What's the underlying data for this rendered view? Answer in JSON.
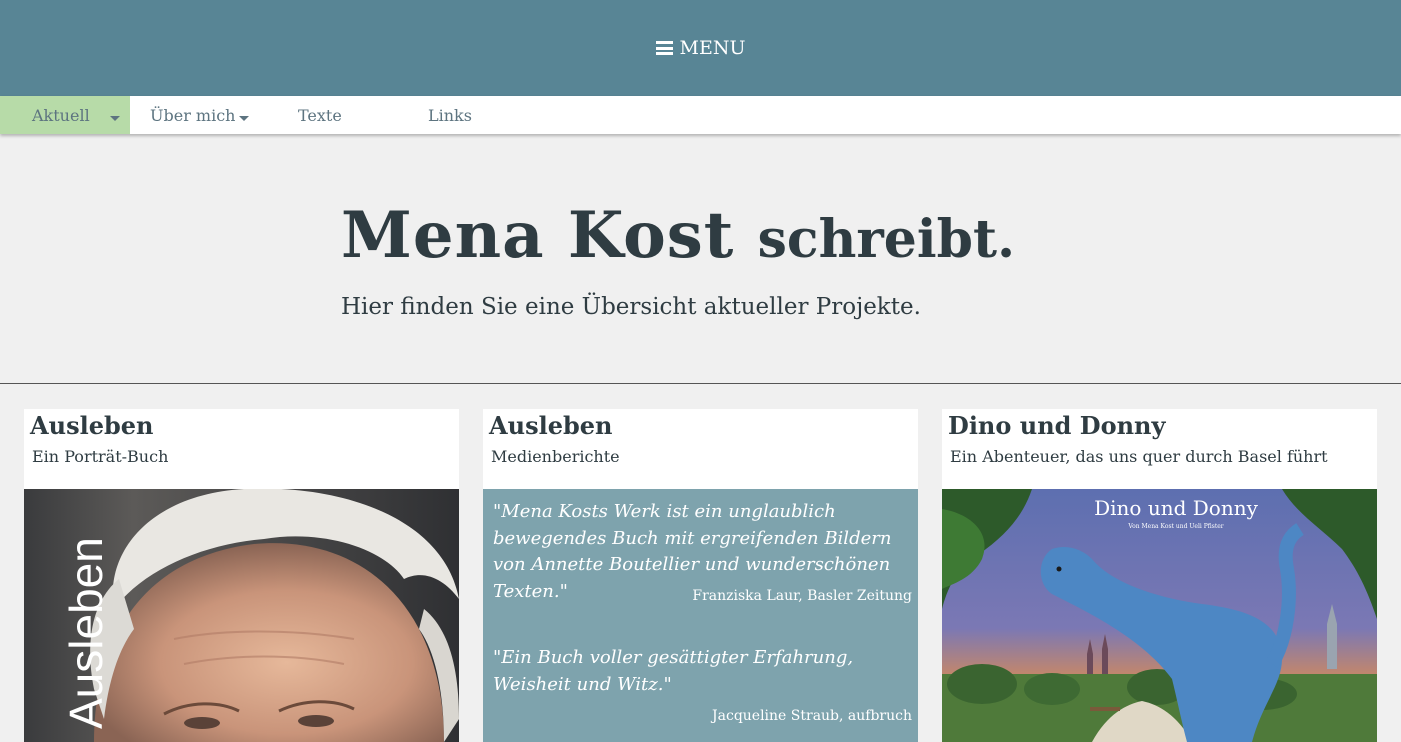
{
  "header": {
    "menu_label": "MENU"
  },
  "nav": {
    "items": [
      {
        "label": "Aktuell"
      },
      {
        "label": "Über mich"
      },
      {
        "label": "Texte"
      },
      {
        "label": "Links"
      }
    ]
  },
  "hero": {
    "title_main": "Mena Kost",
    "title_small": "schreibt.",
    "subtitle": "Hier finden Sie eine Übersicht aktueller Projekte."
  },
  "cards": [
    {
      "title": "Ausleben",
      "subtitle": "Ein Porträt-Buch",
      "cover_text": "Ausleben"
    },
    {
      "title": "Ausleben",
      "subtitle": "Medienberichte",
      "quotes": [
        {
          "text": "\"Mena Kosts Werk ist ein unglaublich bewegendes Buch mit ergreifenden Bildern von Annette Boutellier und wunderschönen Texten.\"",
          "source": "Franziska Laur, Basler Zeitung"
        },
        {
          "text": "\"Ein Buch voller gesättigter Erfahrung, Weisheit und Witz.\"",
          "source": "Jacqueline Straub, aufbruch"
        }
      ]
    },
    {
      "title": "Dino und Donny",
      "subtitle": "Ein Abenteuer, das uns quer durch Basel führt",
      "cover_title": "Dino und Donny",
      "cover_byline": "Von Mena Kost und Ueli Pfister"
    }
  ],
  "colors": {
    "header": "#588595",
    "nav_active": "#b7dba8",
    "quote_bg": "#7ea3ad",
    "text": "#2f3c42"
  }
}
